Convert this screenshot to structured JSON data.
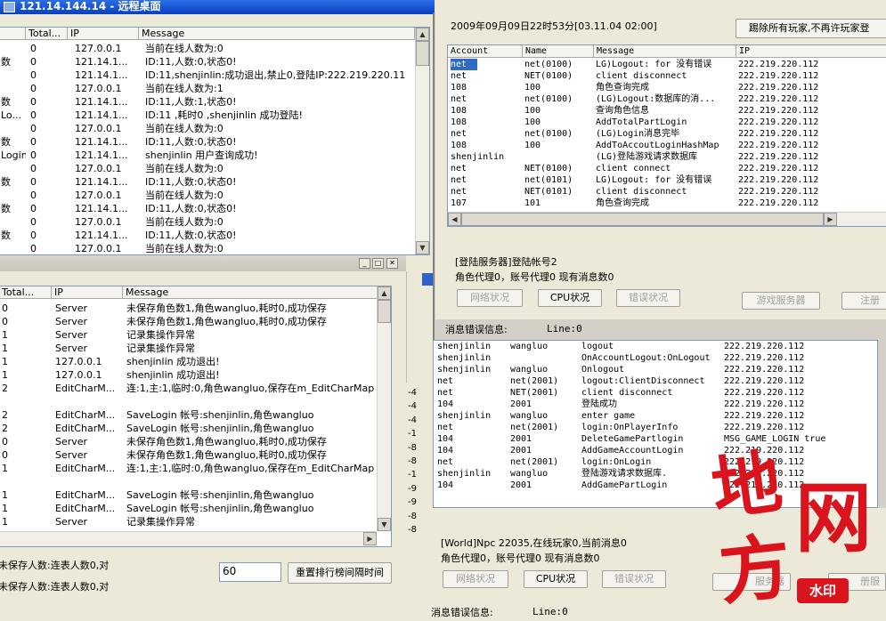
{
  "window_title": "121.14.144.14 - 远程桌面",
  "top_left": {
    "headers": [
      "Total...",
      "IP",
      "Message"
    ],
    "rows": [
      [
        "",
        "0",
        "127.0.0.1",
        "当前在线人数为:0"
      ],
      [
        "数",
        "0",
        "121.14.1...",
        "ID:11,人数:0,状态0!"
      ],
      [
        "",
        "0",
        "121.14.1...",
        "ID:11,shenjinlin:成功退出,禁止0,登陆IP:222.219.220.11"
      ],
      [
        "",
        "0",
        "127.0.0.1",
        "当前在线人数为:1"
      ],
      [
        "数",
        "0",
        "121.14.1...",
        "ID:11,人数:1,状态0!"
      ],
      [
        "Lo...",
        "0",
        "121.14.1...",
        "ID:11 ,耗时0 ,shenjinlin 成功登陆!"
      ],
      [
        "",
        "0",
        "127.0.0.1",
        "当前在线人数为:0"
      ],
      [
        "数",
        "0",
        "121.14.1...",
        "ID:11,人数:0,状态0!"
      ],
      [
        "Login",
        "0",
        "121.14.1...",
        "shenjinlin 用户查询成功!"
      ],
      [
        "",
        "0",
        "127.0.0.1",
        "当前在线人数为:0"
      ],
      [
        "数",
        "0",
        "121.14.1...",
        "ID:11,人数:0,状态0!"
      ],
      [
        "",
        "0",
        "127.0.0.1",
        "当前在线人数为:0"
      ],
      [
        "数",
        "0",
        "121.14.1...",
        "ID:11,人数:0,状态0!"
      ],
      [
        "",
        "0",
        "127.0.0.1",
        "当前在线人数为:0"
      ],
      [
        "数",
        "0",
        "121.14.1...",
        "ID:11,人数:0,状态0!"
      ],
      [
        "",
        "0",
        "127.0.0.1",
        "当前在线人数为:0"
      ]
    ]
  },
  "bottom_left": {
    "headers": [
      "Total...",
      "IP",
      "Message"
    ],
    "rows": [
      [
        "0",
        "Server",
        "未保存角色数1,角色wangluo,耗时0,成功保存"
      ],
      [
        "0",
        "Server",
        "未保存角色数1,角色wangluo,耗时0,成功保存"
      ],
      [
        "1",
        "Server",
        "记录集操作异常"
      ],
      [
        "1",
        "Server",
        "记录集操作异常"
      ],
      [
        "1",
        "127.0.0.1",
        "shenjinlin 成功退出!"
      ],
      [
        "1",
        "127.0.0.1",
        "shenjinlin 成功退出!"
      ],
      [
        "2",
        "EditCharM...",
        "连:1,主:1,临时:0,角色wangluo,保存在m_EditCharMap"
      ],
      [
        "",
        "",
        ""
      ],
      [
        "2",
        "EditCharM...",
        "SaveLogin 帐号:shenjinlin,角色wangluo"
      ],
      [
        "2",
        "EditCharM...",
        "SaveLogin 帐号:shenjinlin,角色wangluo"
      ],
      [
        "0",
        "Server",
        "未保存角色数1,角色wangluo,耗时0,成功保存"
      ],
      [
        "0",
        "Server",
        "未保存角色数1,角色wangluo,耗时0,成功保存"
      ],
      [
        "1",
        "EditCharM...",
        "连:1,主:1,临时:0,角色wangluo,保存在m_EditCharMap"
      ],
      [
        "",
        "",
        ""
      ],
      [
        "1",
        "EditCharM...",
        "SaveLogin 帐号:shenjinlin,角色wangluo"
      ],
      [
        "1",
        "EditCharM...",
        "SaveLogin 帐号:shenjinlin,角色wangluo"
      ],
      [
        "1",
        "Server",
        "记录集操作异常"
      ]
    ],
    "status1": "未保存人数:连表人数0,对",
    "status2": "未保存人数:连表人数0,对",
    "interval_value": "60",
    "reset_button": "重置排行榜间隔时间",
    "side_numbers": [
      "-4",
      "-4",
      "-4",
      "-1",
      "-8",
      "-8",
      "-1",
      "-9",
      "-9",
      "-8",
      "-8"
    ]
  },
  "right_top": {
    "timestamp": "2009年09月09日22时53分[03.11.04 02:00]",
    "kick_button": "踢除所有玩家,不再许玩家登",
    "headers": [
      "Account",
      "Name",
      "Message",
      "IP"
    ],
    "rows": [
      [
        "net",
        "net(0100)",
        "LG)Logout: for 没有错误",
        "222.219.220.112"
      ],
      [
        "net",
        "NET(0100)",
        "client disconnect",
        "222.219.220.112"
      ],
      [
        "108",
        "100",
        "角色查询完成",
        "222.219.220.112"
      ],
      [
        "net",
        "net(0100)",
        "(LG)Logout:数据库的消...",
        "222.219.220.112"
      ],
      [
        "108",
        "100",
        "查询角色信息",
        "222.219.220.112"
      ],
      [
        "108",
        "100",
        "AddTotalPartLogin",
        "222.219.220.112"
      ],
      [
        "net",
        "net(0100)",
        "(LG)Login消息完毕",
        "222.219.220.112"
      ],
      [
        "108",
        "100",
        "AddToAccoutLoginHashMap",
        "222.219.220.112"
      ],
      [
        "shenjinlin",
        "",
        "(LG)登陆游戏请求数据库",
        "222.219.220.112"
      ],
      [
        "net",
        "NET(0100)",
        "client connect",
        "222.219.220.112"
      ],
      [
        "net",
        "net(0101)",
        "LG)Logout: for 没有错误",
        "222.219.220.112"
      ],
      [
        "net",
        "NET(0101)",
        "client disconnect",
        "222.219.220.112"
      ],
      [
        "107",
        "101",
        "角色查询完成",
        "222.219.220.112"
      ]
    ],
    "server_label": "[登陆服务器]登陆帐号2",
    "agent_info": "角色代理0，账号代理0  现有消息数0",
    "buttons": [
      "网络状况",
      "CPU状况",
      "错误状况",
      "游戏服务器",
      "注册"
    ],
    "err_label": "消息错误信息:",
    "line_label": "Line:0"
  },
  "right_bottom": {
    "rows": [
      [
        "shenjinlin",
        "wangluo",
        "logout",
        "222.219.220.112"
      ],
      [
        "shenjinlin",
        "",
        "OnAccountLogout:OnLogout",
        "222.219.220.112"
      ],
      [
        "shenjinlin",
        "wangluo",
        "Onlogout",
        "222.219.220.112"
      ],
      [
        "net",
        "net(2001)",
        "logout:ClientDisconnect",
        "222.219.220.112"
      ],
      [
        "net",
        "NET(2001)",
        "client disconnect",
        "222.219.220.112"
      ],
      [
        "104",
        "2001",
        "登陆成功",
        "222.219.220.112"
      ],
      [
        "shenjinlin",
        "wangluo",
        "enter game",
        "222.219.220.112"
      ],
      [
        "net",
        "net(2001)",
        "login:OnPlayerInfo",
        "222.219.220.112"
      ],
      [
        "104",
        "2001",
        "DeleteGamePartlogin",
        "MSG_GAME_LOGIN true"
      ],
      [
        "104",
        "2001",
        "AddGameAccountLogin",
        "222.219.220.112"
      ],
      [
        "net",
        "net(2001)",
        "login:OnLogin",
        "222.219.220.112"
      ],
      [
        "shenjinlin",
        "wangluo",
        "登陆游戏请求数据库.",
        "222.219.220.112"
      ],
      [
        "104",
        "2001",
        "AddGamePartLogin",
        "222.219.220.112"
      ]
    ],
    "world_label": "[World]Npc 22035,在线玩家0,当前消息0",
    "agent_info": "角色代理0，账号代理0  现有消息数0",
    "buttons": [
      "网络状况",
      "CPU状况",
      "错误状况",
      "服务器",
      "册服"
    ],
    "err_label": "消息错误信息:",
    "line_label": "Line:0"
  },
  "watermark": {
    "line1": "地",
    "line2": "网",
    "line3": "方",
    "badge": "水印",
    "color": "#d9141d"
  }
}
